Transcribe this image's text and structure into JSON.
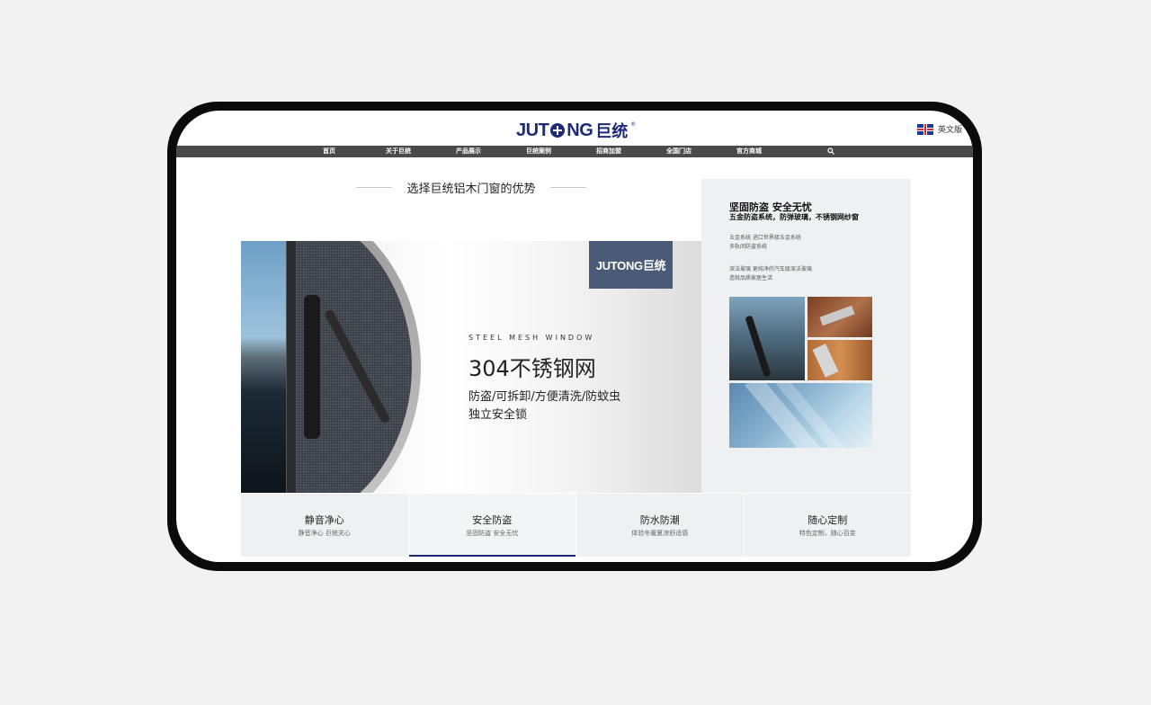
{
  "header": {
    "logo_text": "JUTONG",
    "logo_cn": "巨统",
    "logo_reg": "®",
    "language_label": "英文版"
  },
  "nav": {
    "items": [
      "首页",
      "关于巨统",
      "产品展示",
      "巨统案例",
      "招商加盟",
      "全国门店",
      "官方商城"
    ],
    "search_icon": "search-icon"
  },
  "section": {
    "title": "选择巨统铝木门窗的优势"
  },
  "banner": {
    "logo_text": "JUTONG巨统",
    "subtitle": "STEEL MESH WINDOW",
    "title": "304不锈钢网",
    "line1": "防盗/可拆卸/方便清洗/防蚊虫",
    "line2": "独立安全锁"
  },
  "panel": {
    "title": "坚固防盗 安全无忧",
    "subtitle": "五金防盗系统，防弹玻璃，不锈钢网纱窗",
    "note1_line1": "五金系统 进口世界级五金系统",
    "note1_line2": "多轨闭防盗系统",
    "note2_line1": "深法玻璃 更纯净的汽车级深法玻璃",
    "note2_line2": "造就品质家居生活"
  },
  "tabs": [
    {
      "title": "静音净心",
      "desc": "静音净心 巨统关心"
    },
    {
      "title": "安全防盗",
      "desc": "坚固防盗 安全无忧"
    },
    {
      "title": "防水防潮",
      "desc": "体验冬暖夏凉舒适感"
    },
    {
      "title": "随心定制",
      "desc": "特色定制，随心百变"
    }
  ],
  "colors": {
    "brand": "#1c2a7a",
    "nav_bg": "#4a4a4a",
    "panel_bg": "#eef0f2",
    "device_frame": "#0b0b0b"
  }
}
